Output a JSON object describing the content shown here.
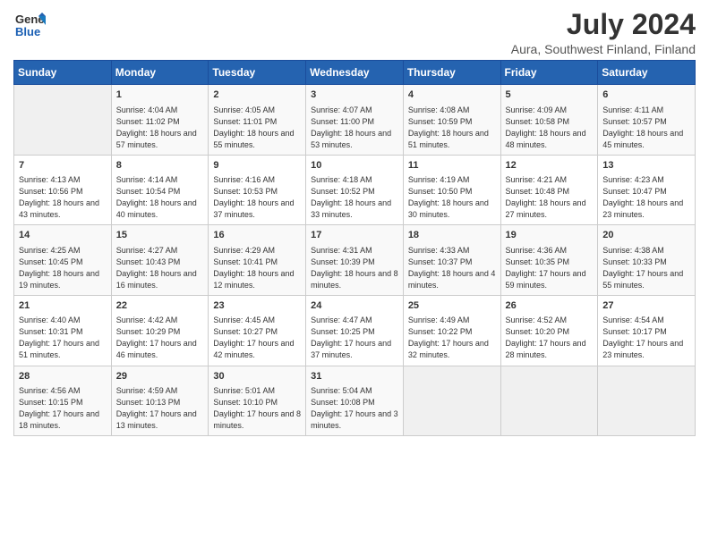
{
  "logo": {
    "line1": "General",
    "line2": "Blue"
  },
  "title": "July 2024",
  "location": "Aura, Southwest Finland, Finland",
  "days_of_week": [
    "Sunday",
    "Monday",
    "Tuesday",
    "Wednesday",
    "Thursday",
    "Friday",
    "Saturday"
  ],
  "weeks": [
    [
      {
        "day": "",
        "empty": true
      },
      {
        "day": "1",
        "sunrise": "Sunrise: 4:04 AM",
        "sunset": "Sunset: 11:02 PM",
        "daylight": "Daylight: 18 hours and 57 minutes."
      },
      {
        "day": "2",
        "sunrise": "Sunrise: 4:05 AM",
        "sunset": "Sunset: 11:01 PM",
        "daylight": "Daylight: 18 hours and 55 minutes."
      },
      {
        "day": "3",
        "sunrise": "Sunrise: 4:07 AM",
        "sunset": "Sunset: 11:00 PM",
        "daylight": "Daylight: 18 hours and 53 minutes."
      },
      {
        "day": "4",
        "sunrise": "Sunrise: 4:08 AM",
        "sunset": "Sunset: 10:59 PM",
        "daylight": "Daylight: 18 hours and 51 minutes."
      },
      {
        "day": "5",
        "sunrise": "Sunrise: 4:09 AM",
        "sunset": "Sunset: 10:58 PM",
        "daylight": "Daylight: 18 hours and 48 minutes."
      },
      {
        "day": "6",
        "sunrise": "Sunrise: 4:11 AM",
        "sunset": "Sunset: 10:57 PM",
        "daylight": "Daylight: 18 hours and 45 minutes."
      }
    ],
    [
      {
        "day": "7",
        "sunrise": "Sunrise: 4:13 AM",
        "sunset": "Sunset: 10:56 PM",
        "daylight": "Daylight: 18 hours and 43 minutes."
      },
      {
        "day": "8",
        "sunrise": "Sunrise: 4:14 AM",
        "sunset": "Sunset: 10:54 PM",
        "daylight": "Daylight: 18 hours and 40 minutes."
      },
      {
        "day": "9",
        "sunrise": "Sunrise: 4:16 AM",
        "sunset": "Sunset: 10:53 PM",
        "daylight": "Daylight: 18 hours and 37 minutes."
      },
      {
        "day": "10",
        "sunrise": "Sunrise: 4:18 AM",
        "sunset": "Sunset: 10:52 PM",
        "daylight": "Daylight: 18 hours and 33 minutes."
      },
      {
        "day": "11",
        "sunrise": "Sunrise: 4:19 AM",
        "sunset": "Sunset: 10:50 PM",
        "daylight": "Daylight: 18 hours and 30 minutes."
      },
      {
        "day": "12",
        "sunrise": "Sunrise: 4:21 AM",
        "sunset": "Sunset: 10:48 PM",
        "daylight": "Daylight: 18 hours and 27 minutes."
      },
      {
        "day": "13",
        "sunrise": "Sunrise: 4:23 AM",
        "sunset": "Sunset: 10:47 PM",
        "daylight": "Daylight: 18 hours and 23 minutes."
      }
    ],
    [
      {
        "day": "14",
        "sunrise": "Sunrise: 4:25 AM",
        "sunset": "Sunset: 10:45 PM",
        "daylight": "Daylight: 18 hours and 19 minutes."
      },
      {
        "day": "15",
        "sunrise": "Sunrise: 4:27 AM",
        "sunset": "Sunset: 10:43 PM",
        "daylight": "Daylight: 18 hours and 16 minutes."
      },
      {
        "day": "16",
        "sunrise": "Sunrise: 4:29 AM",
        "sunset": "Sunset: 10:41 PM",
        "daylight": "Daylight: 18 hours and 12 minutes."
      },
      {
        "day": "17",
        "sunrise": "Sunrise: 4:31 AM",
        "sunset": "Sunset: 10:39 PM",
        "daylight": "Daylight: 18 hours and 8 minutes."
      },
      {
        "day": "18",
        "sunrise": "Sunrise: 4:33 AM",
        "sunset": "Sunset: 10:37 PM",
        "daylight": "Daylight: 18 hours and 4 minutes."
      },
      {
        "day": "19",
        "sunrise": "Sunrise: 4:36 AM",
        "sunset": "Sunset: 10:35 PM",
        "daylight": "Daylight: 17 hours and 59 minutes."
      },
      {
        "day": "20",
        "sunrise": "Sunrise: 4:38 AM",
        "sunset": "Sunset: 10:33 PM",
        "daylight": "Daylight: 17 hours and 55 minutes."
      }
    ],
    [
      {
        "day": "21",
        "sunrise": "Sunrise: 4:40 AM",
        "sunset": "Sunset: 10:31 PM",
        "daylight": "Daylight: 17 hours and 51 minutes."
      },
      {
        "day": "22",
        "sunrise": "Sunrise: 4:42 AM",
        "sunset": "Sunset: 10:29 PM",
        "daylight": "Daylight: 17 hours and 46 minutes."
      },
      {
        "day": "23",
        "sunrise": "Sunrise: 4:45 AM",
        "sunset": "Sunset: 10:27 PM",
        "daylight": "Daylight: 17 hours and 42 minutes."
      },
      {
        "day": "24",
        "sunrise": "Sunrise: 4:47 AM",
        "sunset": "Sunset: 10:25 PM",
        "daylight": "Daylight: 17 hours and 37 minutes."
      },
      {
        "day": "25",
        "sunrise": "Sunrise: 4:49 AM",
        "sunset": "Sunset: 10:22 PM",
        "daylight": "Daylight: 17 hours and 32 minutes."
      },
      {
        "day": "26",
        "sunrise": "Sunrise: 4:52 AM",
        "sunset": "Sunset: 10:20 PM",
        "daylight": "Daylight: 17 hours and 28 minutes."
      },
      {
        "day": "27",
        "sunrise": "Sunrise: 4:54 AM",
        "sunset": "Sunset: 10:17 PM",
        "daylight": "Daylight: 17 hours and 23 minutes."
      }
    ],
    [
      {
        "day": "28",
        "sunrise": "Sunrise: 4:56 AM",
        "sunset": "Sunset: 10:15 PM",
        "daylight": "Daylight: 17 hours and 18 minutes."
      },
      {
        "day": "29",
        "sunrise": "Sunrise: 4:59 AM",
        "sunset": "Sunset: 10:13 PM",
        "daylight": "Daylight: 17 hours and 13 minutes."
      },
      {
        "day": "30",
        "sunrise": "Sunrise: 5:01 AM",
        "sunset": "Sunset: 10:10 PM",
        "daylight": "Daylight: 17 hours and 8 minutes."
      },
      {
        "day": "31",
        "sunrise": "Sunrise: 5:04 AM",
        "sunset": "Sunset: 10:08 PM",
        "daylight": "Daylight: 17 hours and 3 minutes."
      },
      {
        "day": "",
        "empty": true
      },
      {
        "day": "",
        "empty": true
      },
      {
        "day": "",
        "empty": true
      }
    ]
  ]
}
